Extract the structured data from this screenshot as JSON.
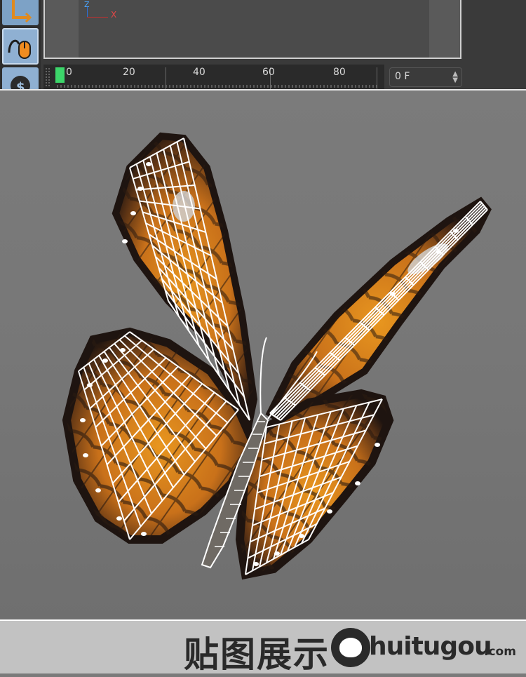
{
  "toolbar": {
    "tools": [
      {
        "icon": "axis-tool-icon"
      },
      {
        "icon": "mouse-tool-icon"
      },
      {
        "icon": "dollar-tool-icon"
      }
    ]
  },
  "viewport": {
    "axis_z_label": "Z",
    "axis_x_label": "X"
  },
  "timeline": {
    "ticks": [
      "0",
      "20",
      "40",
      "60",
      "80"
    ],
    "current_frame": "0 F"
  },
  "caption": {
    "title": "贴图展示",
    "watermark": "huitugou",
    "watermark_suffix": ".com"
  },
  "colors": {
    "wing_orange": "#d9861e",
    "wing_black": "#1e1410",
    "wireframe": "#ffffff",
    "playhead": "#3cd66a"
  }
}
